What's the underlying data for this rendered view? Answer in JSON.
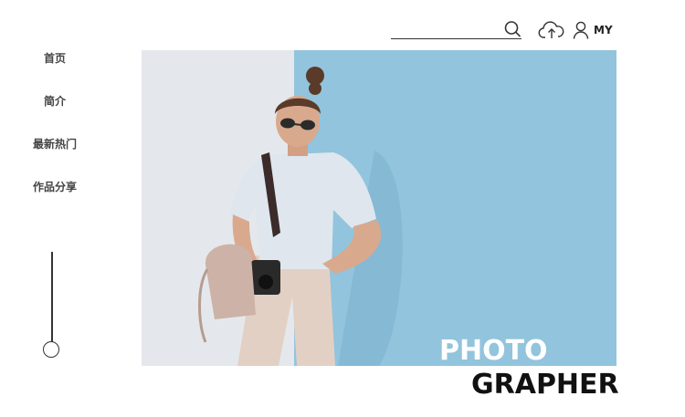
{
  "header": {
    "search_placeholder": "",
    "user_label": "MY",
    "icons": [
      "search-icon",
      "cloud-upload-icon",
      "user-icon"
    ]
  },
  "nav": {
    "items": [
      {
        "label": "首页"
      },
      {
        "label": "简介"
      },
      {
        "label": "最新热门"
      },
      {
        "label": "作品分享"
      }
    ]
  },
  "hero": {
    "brand_line1": "PHOTO",
    "brand_line2": "GRAPHER"
  },
  "colors": {
    "wall_blue": "#8ec0da",
    "wall_white": "#e4e8ec",
    "brand_white": "#ffffff",
    "brand_black": "#111111"
  }
}
